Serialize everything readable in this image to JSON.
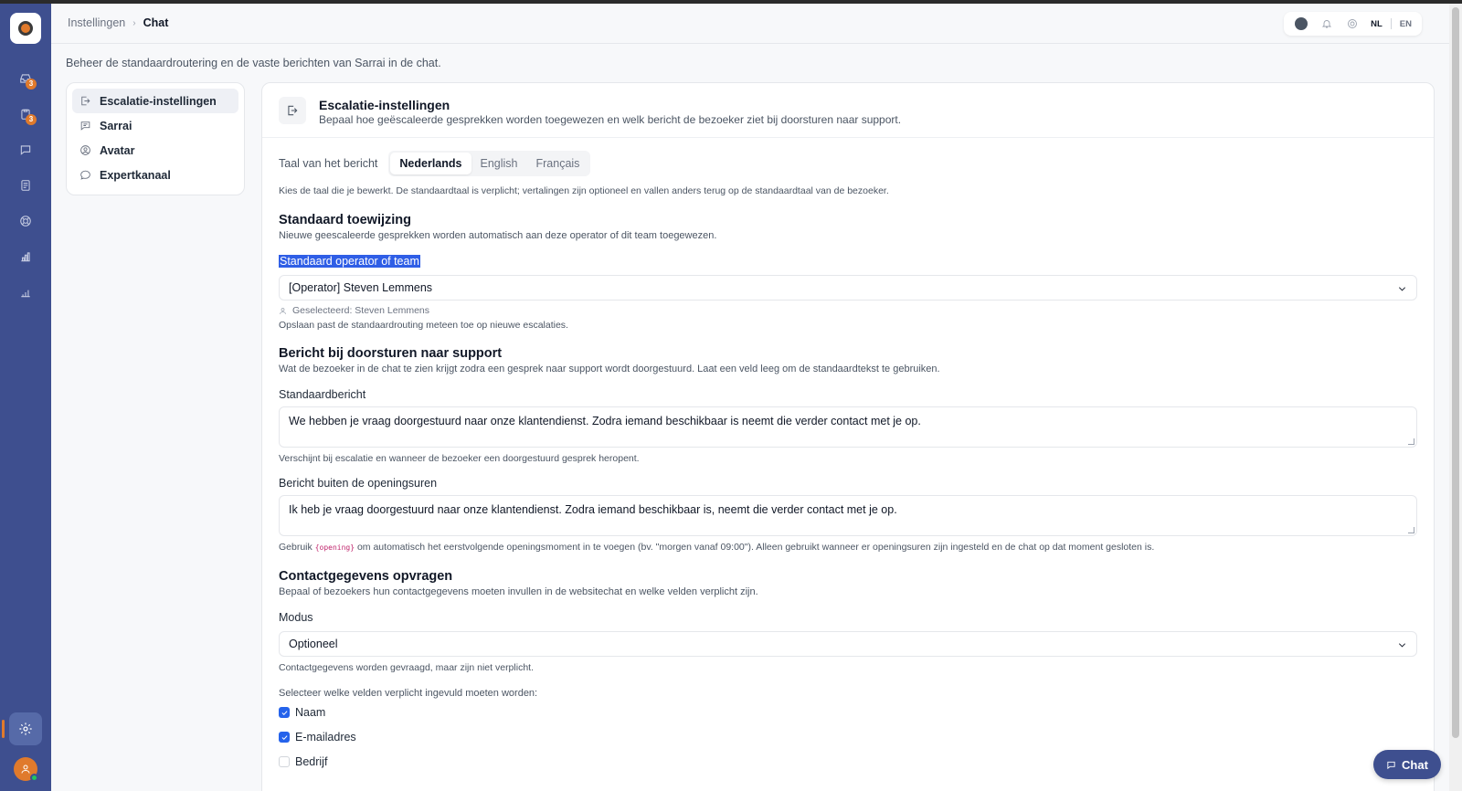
{
  "breadcrumb": {
    "parent": "Instellingen",
    "current": "Chat"
  },
  "rail": {
    "items": [
      {
        "icon": "inbox-icon",
        "badge": "3"
      },
      {
        "icon": "clipboard-icon",
        "badge": "3"
      },
      {
        "icon": "chat-bubble-icon",
        "badge": ""
      },
      {
        "icon": "document-icon",
        "badge": ""
      },
      {
        "icon": "lifebuoy-icon",
        "badge": ""
      },
      {
        "icon": "bar-chart-icon",
        "badge": ""
      },
      {
        "icon": "stats-icon",
        "badge": ""
      }
    ],
    "active": "settings"
  },
  "topbar": {
    "lang_nl": "NL",
    "lang_en": "EN",
    "active_lang": "NL"
  },
  "page": {
    "description": "Beheer de standaardroutering en de vaste berichten van Sarrai in de chat."
  },
  "subnav": {
    "items": [
      {
        "label": "Escalatie-instellingen",
        "icon": "escalation-icon",
        "active": true
      },
      {
        "label": "Sarrai",
        "icon": "message-icon",
        "active": false
      },
      {
        "label": "Avatar",
        "icon": "user-circle-icon",
        "active": false
      },
      {
        "label": "Expertkanaal",
        "icon": "chat-dots-icon",
        "active": false
      }
    ]
  },
  "panel": {
    "title": "Escalatie-instellingen",
    "subtitle": "Bepaal hoe geëscaleerde gesprekken worden toegewezen en welk bericht de bezoeker ziet bij doorsturen naar support.",
    "language": {
      "label": "Taal van het bericht",
      "tabs": [
        "Nederlands",
        "English",
        "Français"
      ],
      "active": "Nederlands",
      "hint": "Kies de taal die je bewerkt. De standaardtaal is verplicht; vertalingen zijn optioneel en vallen anders terug op de standaardtaal van de bezoeker."
    },
    "assignment": {
      "heading": "Standaard toewijzing",
      "description": "Nieuwe geescaleerde gesprekken worden automatisch aan deze operator of dit team toegewezen.",
      "field_label": "Standaard operator of team",
      "value": "[Operator] Steven Lemmens",
      "selected_info": "Geselecteerd: Steven Lemmens",
      "save_hint": "Opslaan past de standaardrouting meteen toe op nieuwe escalaties."
    },
    "forward_message": {
      "heading": "Bericht bij doorsturen naar support",
      "description": "Wat de bezoeker in de chat te zien krijgt zodra een gesprek naar support wordt doorgestuurd. Laat een veld leeg om de standaardtekst te gebruiken.",
      "default_label": "Standaardbericht",
      "default_value": "We hebben je vraag doorgestuurd naar onze klantendienst. Zodra iemand beschikbaar is neemt die verder contact met je op.",
      "default_hint": "Verschijnt bij escalatie en wanneer de bezoeker een doorgestuurd gesprek heropent.",
      "after_hours_label": "Bericht buiten de openingsuren",
      "after_hours_value": "Ik heb je vraag doorgestuurd naar onze klantendienst. Zodra iemand beschikbaar is, neemt die verder contact met je op.",
      "after_hours_hint_pre": "Gebruik",
      "after_hours_code": "{opening}",
      "after_hours_hint_post": "om automatisch het eerstvolgende openingsmoment in te voegen (bv. \"morgen vanaf 09:00\"). Alleen gebruikt wanneer er openingsuren zijn ingesteld en de chat op dat moment gesloten is."
    },
    "contact": {
      "heading": "Contactgegevens opvragen",
      "description": "Bepaal of bezoekers hun contactgegevens moeten invullen in de websitechat en welke velden verplicht zijn.",
      "mode_label": "Modus",
      "mode_value": "Optioneel",
      "mode_hint": "Contactgegevens worden gevraagd, maar zijn niet verplicht.",
      "fields_label": "Selecteer welke velden verplicht ingevuld moeten worden:",
      "fields": [
        {
          "label": "Naam",
          "checked": true
        },
        {
          "label": "E-mailadres",
          "checked": true
        },
        {
          "label": "Bedrijf",
          "checked": false
        }
      ]
    }
  },
  "chat_button": {
    "label": "Chat"
  },
  "colors": {
    "rail": "#3e4f8f",
    "accent": "#e07a2c",
    "checkbox": "#2563eb"
  }
}
